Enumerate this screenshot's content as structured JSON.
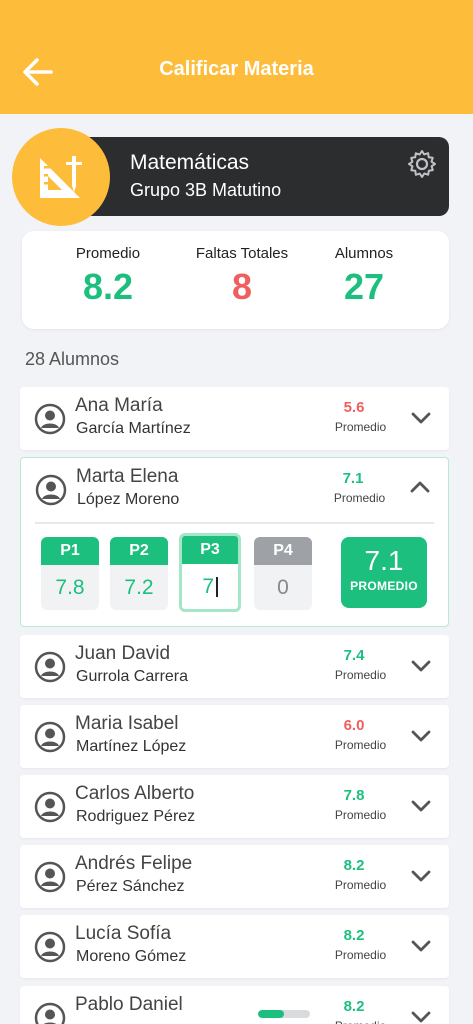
{
  "header": {
    "title": "Calificar Materia"
  },
  "subject": {
    "name": "Matemáticas",
    "group": "Grupo 3B Matutino"
  },
  "stats": [
    {
      "label": "Promedio",
      "value": "8.2",
      "color": "#1dbf7e"
    },
    {
      "label": "Faltas Totales",
      "value": "8",
      "color": "#ef5f5f"
    },
    {
      "label": "Alumnos",
      "value": "27",
      "color": "#1dbf7e"
    }
  ],
  "students_count_label": "28 Alumnos",
  "promedio_label": "Promedio",
  "students": [
    {
      "first": "Ana María",
      "last": "García Martínez",
      "grade": "5.6",
      "status": "low"
    },
    {
      "first": "Marta Elena",
      "last": "López Moreno",
      "grade": "7.1",
      "status": "ok",
      "expanded": true
    },
    {
      "first": "Juan David",
      "last": "Gurrola Carrera",
      "grade": "7.4",
      "status": "ok"
    },
    {
      "first": "Maria Isabel",
      "last": "Martínez López",
      "grade": "6.0",
      "status": "low"
    },
    {
      "first": "Carlos Alberto",
      "last": "Rodriguez Pérez",
      "grade": "7.8",
      "status": "ok"
    },
    {
      "first": "Andrés Felipe",
      "last": "Pérez Sánchez",
      "grade": "8.2",
      "status": "ok"
    },
    {
      "first": "Lucía Sofía",
      "last": "Moreno Gómez",
      "grade": "8.2",
      "status": "ok"
    },
    {
      "first": "Pablo Daniel",
      "last": "",
      "grade": "8.2",
      "status": "ok",
      "progress": 0.5
    }
  ],
  "expanded_detail": {
    "periods": [
      {
        "label": "P1",
        "value": "7.8",
        "state": "filled"
      },
      {
        "label": "P2",
        "value": "7.2",
        "state": "filled"
      },
      {
        "label": "P3",
        "value": "7",
        "state": "editing"
      },
      {
        "label": "P4",
        "value": "0",
        "state": "empty"
      }
    ],
    "average_value": "7.1",
    "average_label": "PROMEDIO"
  },
  "colors": {
    "accent": "#fdbd3a",
    "good": "#1dbf7e",
    "bad": "#ef5f5f",
    "dark": "#2c2d2f"
  }
}
